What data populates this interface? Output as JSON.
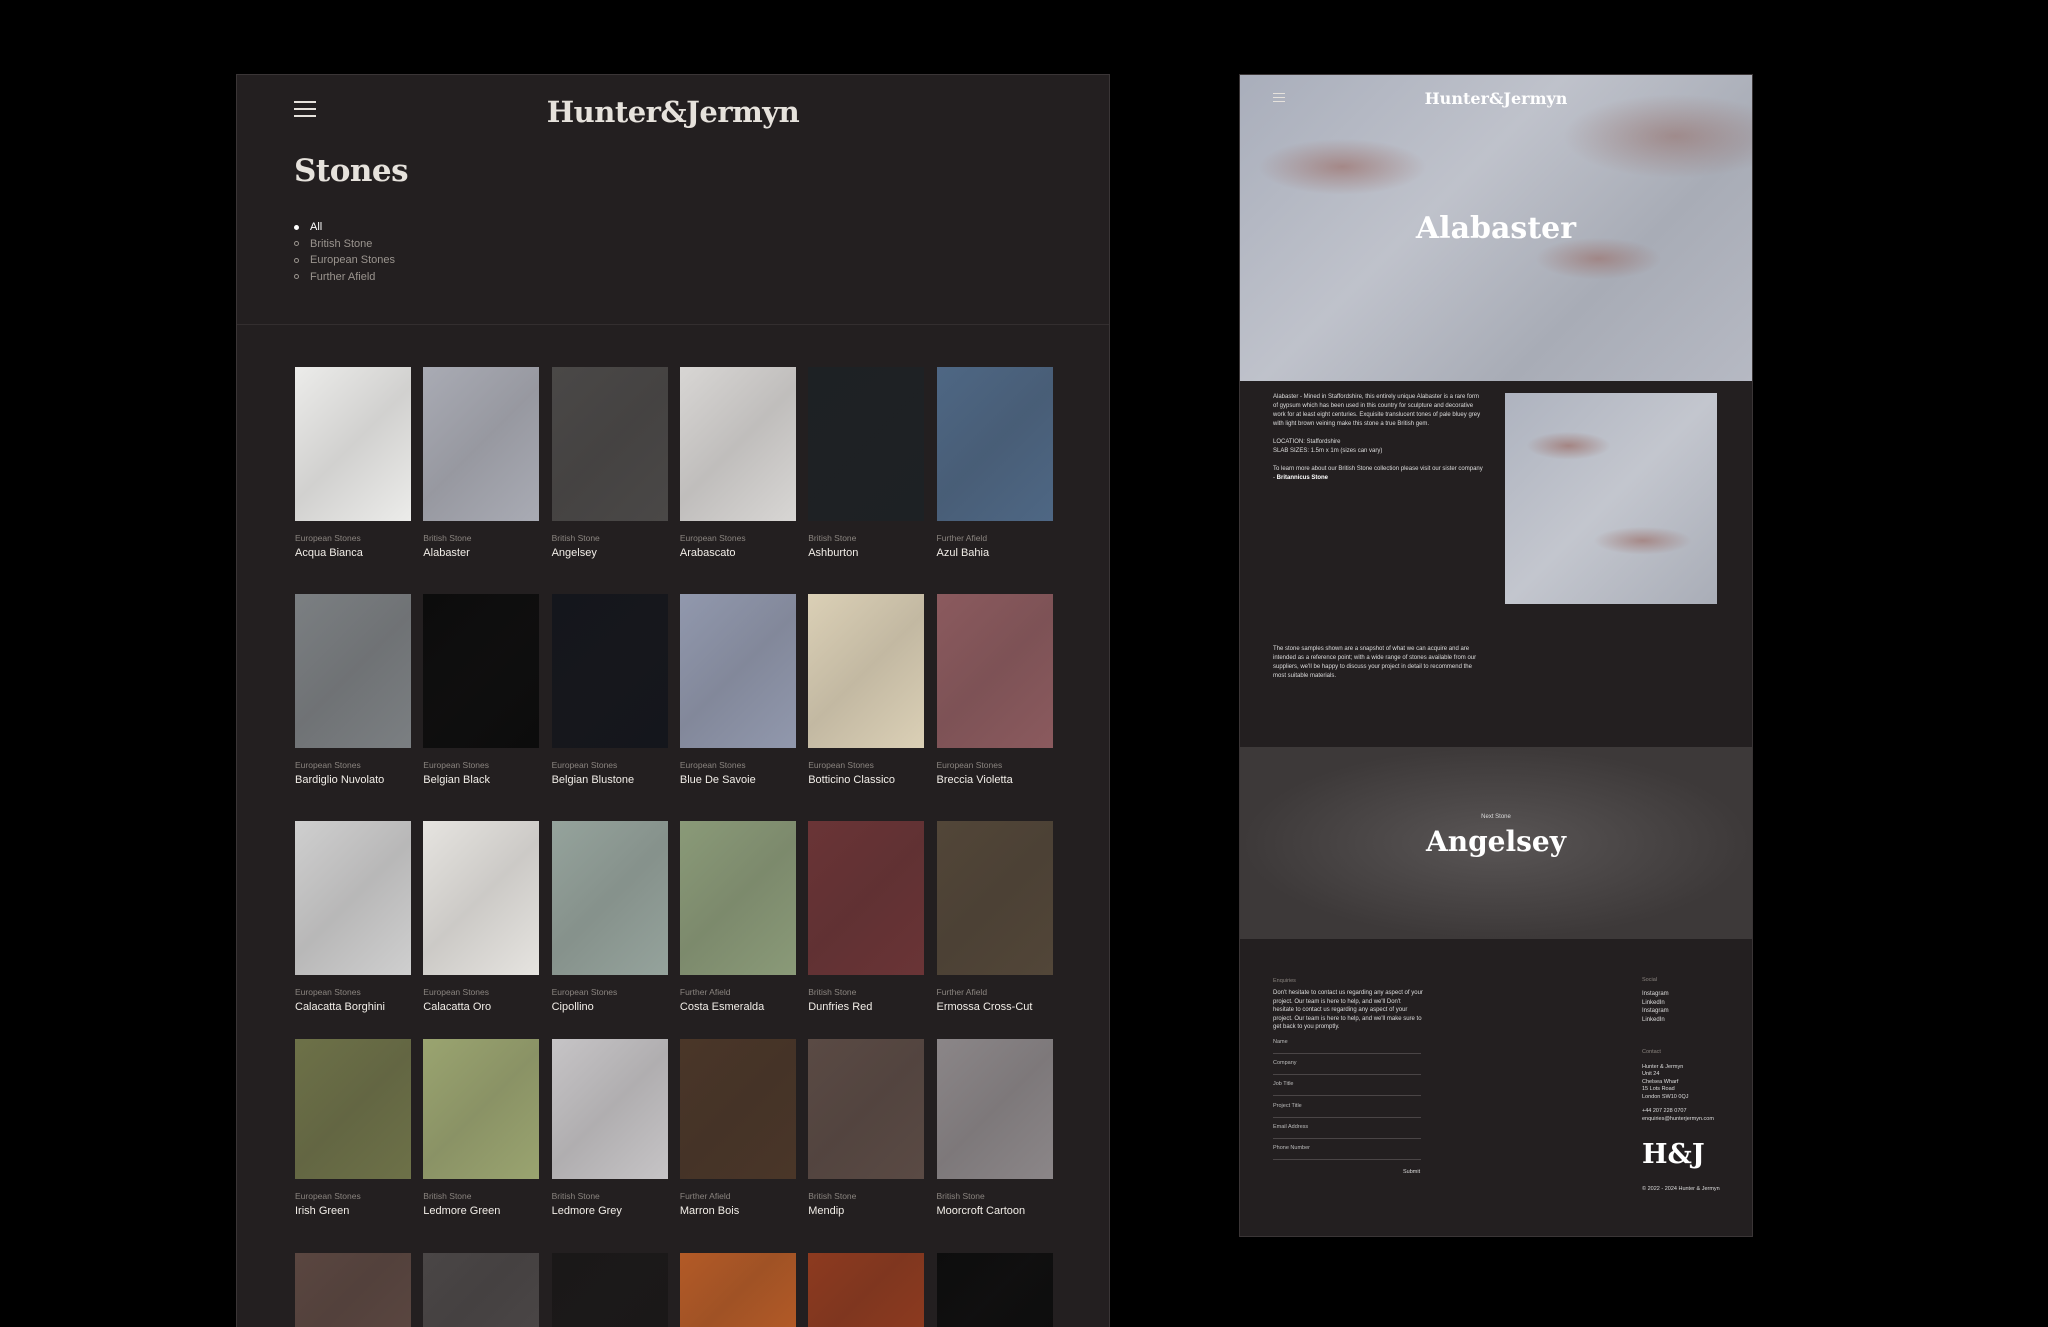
{
  "left": {
    "logo": "Hunter&Jermyn",
    "title": "Stones",
    "filters": [
      {
        "label": "All",
        "active": true
      },
      {
        "label": "British Stone",
        "active": false
      },
      {
        "label": "European Stones",
        "active": false
      },
      {
        "label": "Further Afield",
        "active": false
      }
    ],
    "stones": [
      {
        "cat": "European Stones",
        "name": "Acqua Bianca",
        "color": "#ececea"
      },
      {
        "cat": "British Stone",
        "name": "Alabaster",
        "color": "#a9abb4"
      },
      {
        "cat": "British Stone",
        "name": "Angelsey",
        "color": "#4a4847"
      },
      {
        "cat": "European Stones",
        "name": "Arabascato",
        "color": "#d8d6d4"
      },
      {
        "cat": "British Stone",
        "name": "Ashburton",
        "color": "#1d2124"
      },
      {
        "cat": "Further Afield",
        "name": "Azul Bahia",
        "color": "#4e6784"
      },
      {
        "cat": "European Stones",
        "name": "Bardiglio Nuvolato",
        "color": "#7b7f82"
      },
      {
        "cat": "European Stones",
        "name": "Belgian Black",
        "color": "#0c0c0c"
      },
      {
        "cat": "European Stones",
        "name": "Belgian Blustone",
        "color": "#14161c"
      },
      {
        "cat": "European Stones",
        "name": "Blue De Savoie",
        "color": "#9198ad"
      },
      {
        "cat": "European Stones",
        "name": "Botticino Classico",
        "color": "#dbd0b6"
      },
      {
        "cat": "European Stones",
        "name": "Breccia Violetta",
        "color": "#8b5a5e"
      },
      {
        "cat": "European Stones",
        "name": "Calacatta Borghini",
        "color": "#cfcfcf"
      },
      {
        "cat": "European Stones",
        "name": "Calacatta Oro",
        "color": "#e6e4e0"
      },
      {
        "cat": "European Stones",
        "name": "Cipollino",
        "color": "#95a39c"
      },
      {
        "cat": "Further Afield",
        "name": "Costa Esmeralda",
        "color": "#8a9a78"
      },
      {
        "cat": "British Stone",
        "name": "Dunfries Red",
        "color": "#6a3436"
      },
      {
        "cat": "Further Afield",
        "name": "Ermossa Cross-Cut",
        "color": "#524638"
      },
      {
        "cat": "European Stones",
        "name": "Irish Green",
        "color": "#6d7148"
      },
      {
        "cat": "British Stone",
        "name": "Ledmore Green",
        "color": "#9aa470"
      },
      {
        "cat": "British Stone",
        "name": "Ledmore Grey",
        "color": "#c6c4c6"
      },
      {
        "cat": "Further Afield",
        "name": "Marron Bois",
        "color": "#4a3628"
      },
      {
        "cat": "British Stone",
        "name": "Mendip",
        "color": "#5a4a44"
      },
      {
        "cat": "British Stone",
        "name": "Moorcroft Cartoon",
        "color": "#8b8688"
      },
      {
        "cat": "",
        "name": "",
        "color": "#5a4640"
      },
      {
        "cat": "",
        "name": "",
        "color": "#4a4646"
      },
      {
        "cat": "",
        "name": "",
        "color": "#1a1818"
      },
      {
        "cat": "",
        "name": "",
        "color": "#b35a26"
      },
      {
        "cat": "",
        "name": "",
        "color": "#8d3a1f"
      },
      {
        "cat": "",
        "name": "",
        "color": "#0d0d0d"
      }
    ]
  },
  "right": {
    "logo": "Hunter&Jermyn",
    "hero_title": "Alabaster",
    "description": "Alabaster - Mined in Staffordshire, this entirely unique Alabaster is a rare form of gypsum which has been used in this country for sculpture and decorative work for at least eight centuries. Exquisite translucent tones of pale bluey grey with light brown veining make this stone a true British gem.",
    "location": "LOCATION: Staffordshire",
    "slab_sizes": "SLAB SIZES: 1.5m x 1m (sizes can vary)",
    "learn_more": "To learn more about our British Stone collection please visit our sister company - ",
    "learn_more_link": "Britannicus Stone",
    "notice": "The stone samples shown are a snapshot of what we can acquire and are intended as a reference point; with a wide range of stones available from our suppliers, we'll be happy to discuss your project in detail to recommend the most suitable materials.",
    "next_label": "Next Stone",
    "next_title": "Angelsey",
    "footer": {
      "enquiries_heading": "Enquiries",
      "enquiries_text": "Don't hesitate to contact us regarding any aspect of your project. Our team is here to help, and we'll Don't hesitate to contact us regarding any aspect of your project. Our team is here to help, and we'll make sure to get back to you promptly.",
      "fields": [
        "Name",
        "Company",
        "Job Title",
        "Project Title",
        "Email Address",
        "Phone Number"
      ],
      "submit": "Submit",
      "social_heading": "Social",
      "social": [
        "Instagram",
        "LinkedIn",
        "Instagram",
        "LinkedIn"
      ],
      "contact_heading": "Contact",
      "address": [
        "Hunter & Jermyn",
        "Unit 24",
        "Chelsea Wharf",
        "15 Lots Road",
        "London SW10 0QJ"
      ],
      "phone": "+44 207 228 0707",
      "email": "enquiries@hunterjermyn.com",
      "monogram": "H&J",
      "copyright": "© 2022 - 2024 Hunter & Jermyn"
    }
  }
}
